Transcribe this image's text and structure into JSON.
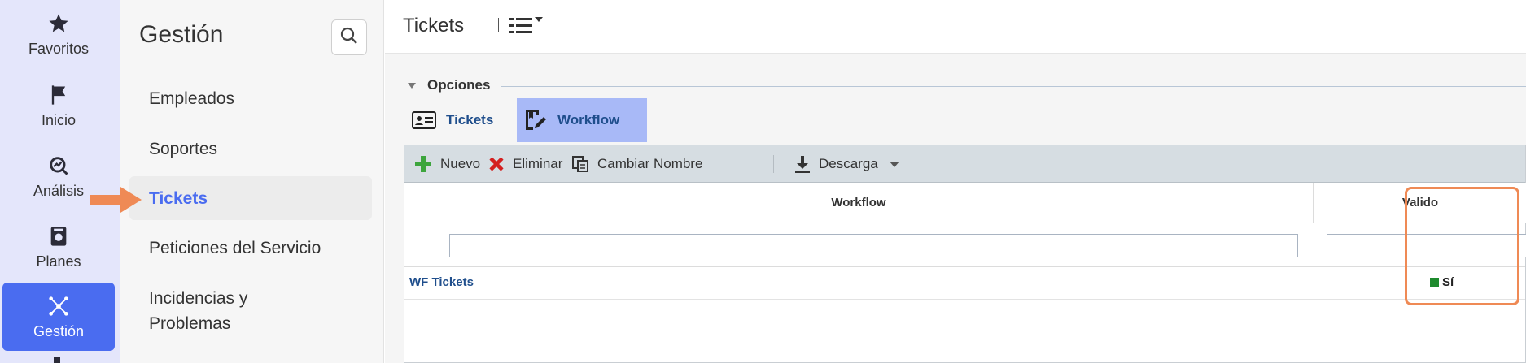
{
  "rail": {
    "items": [
      {
        "label": "Favoritos",
        "icon": "star-icon"
      },
      {
        "label": "Inicio",
        "icon": "flag-icon"
      },
      {
        "label": "Análisis",
        "icon": "analysis-icon"
      },
      {
        "label": "Planes",
        "icon": "plans-icon"
      },
      {
        "label": "Gestión",
        "icon": "network-icon",
        "active": true
      }
    ]
  },
  "subnav": {
    "title": "Gestión",
    "search_icon": "search-icon",
    "items": [
      {
        "label": "Empleados"
      },
      {
        "label": "Soportes"
      },
      {
        "label": "Tickets",
        "active": true
      },
      {
        "label": "Peticiones del Servicio"
      },
      {
        "label": "Incidencias y Problemas"
      }
    ]
  },
  "header": {
    "title": "Tickets",
    "view_toggle_icon": "list-view-icon"
  },
  "options": {
    "label": "Opciones",
    "tabs": [
      {
        "label": "Tickets",
        "icon": "id-card-icon"
      },
      {
        "label": "Workflow",
        "icon": "workflow-edit-icon",
        "active": true
      }
    ]
  },
  "toolbar": {
    "new_label": "Nuevo",
    "delete_label": "Eliminar",
    "rename_label": "Cambiar Nombre",
    "download_label": "Descarga"
  },
  "table": {
    "columns": [
      "Workflow",
      "Valido"
    ],
    "filters": [
      "",
      ""
    ],
    "rows": [
      {
        "workflow": "WF Tickets",
        "valido": "Sí"
      }
    ]
  },
  "colors": {
    "accent": "#4a6cf0",
    "active_tab": "#a8b9f7",
    "link": "#1f4e8c",
    "valid_green": "#1e8a2e",
    "annotation": "#ef8a55"
  }
}
